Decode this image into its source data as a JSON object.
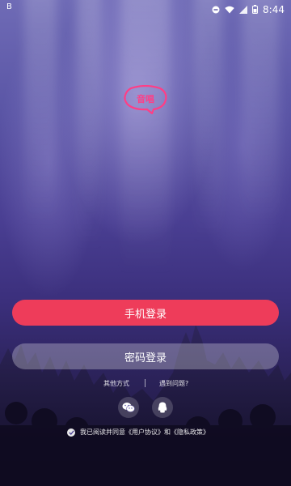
{
  "status_bar": {
    "left_text": "B",
    "time": "8:44"
  },
  "logo": {
    "text": "音唱"
  },
  "login": {
    "phone_label": "手机登录",
    "password_label": "密码登录"
  },
  "links": {
    "other_methods": "其他方式",
    "problem": "遇到问题?"
  },
  "social": {
    "items": [
      "wechat-icon",
      "qq-icon"
    ]
  },
  "agreement": {
    "text": "我已阅读并同意《用户协议》和《隐私政策》"
  },
  "colors": {
    "primary": "#ee3c5a",
    "logo_pink": "#ff3e86"
  }
}
